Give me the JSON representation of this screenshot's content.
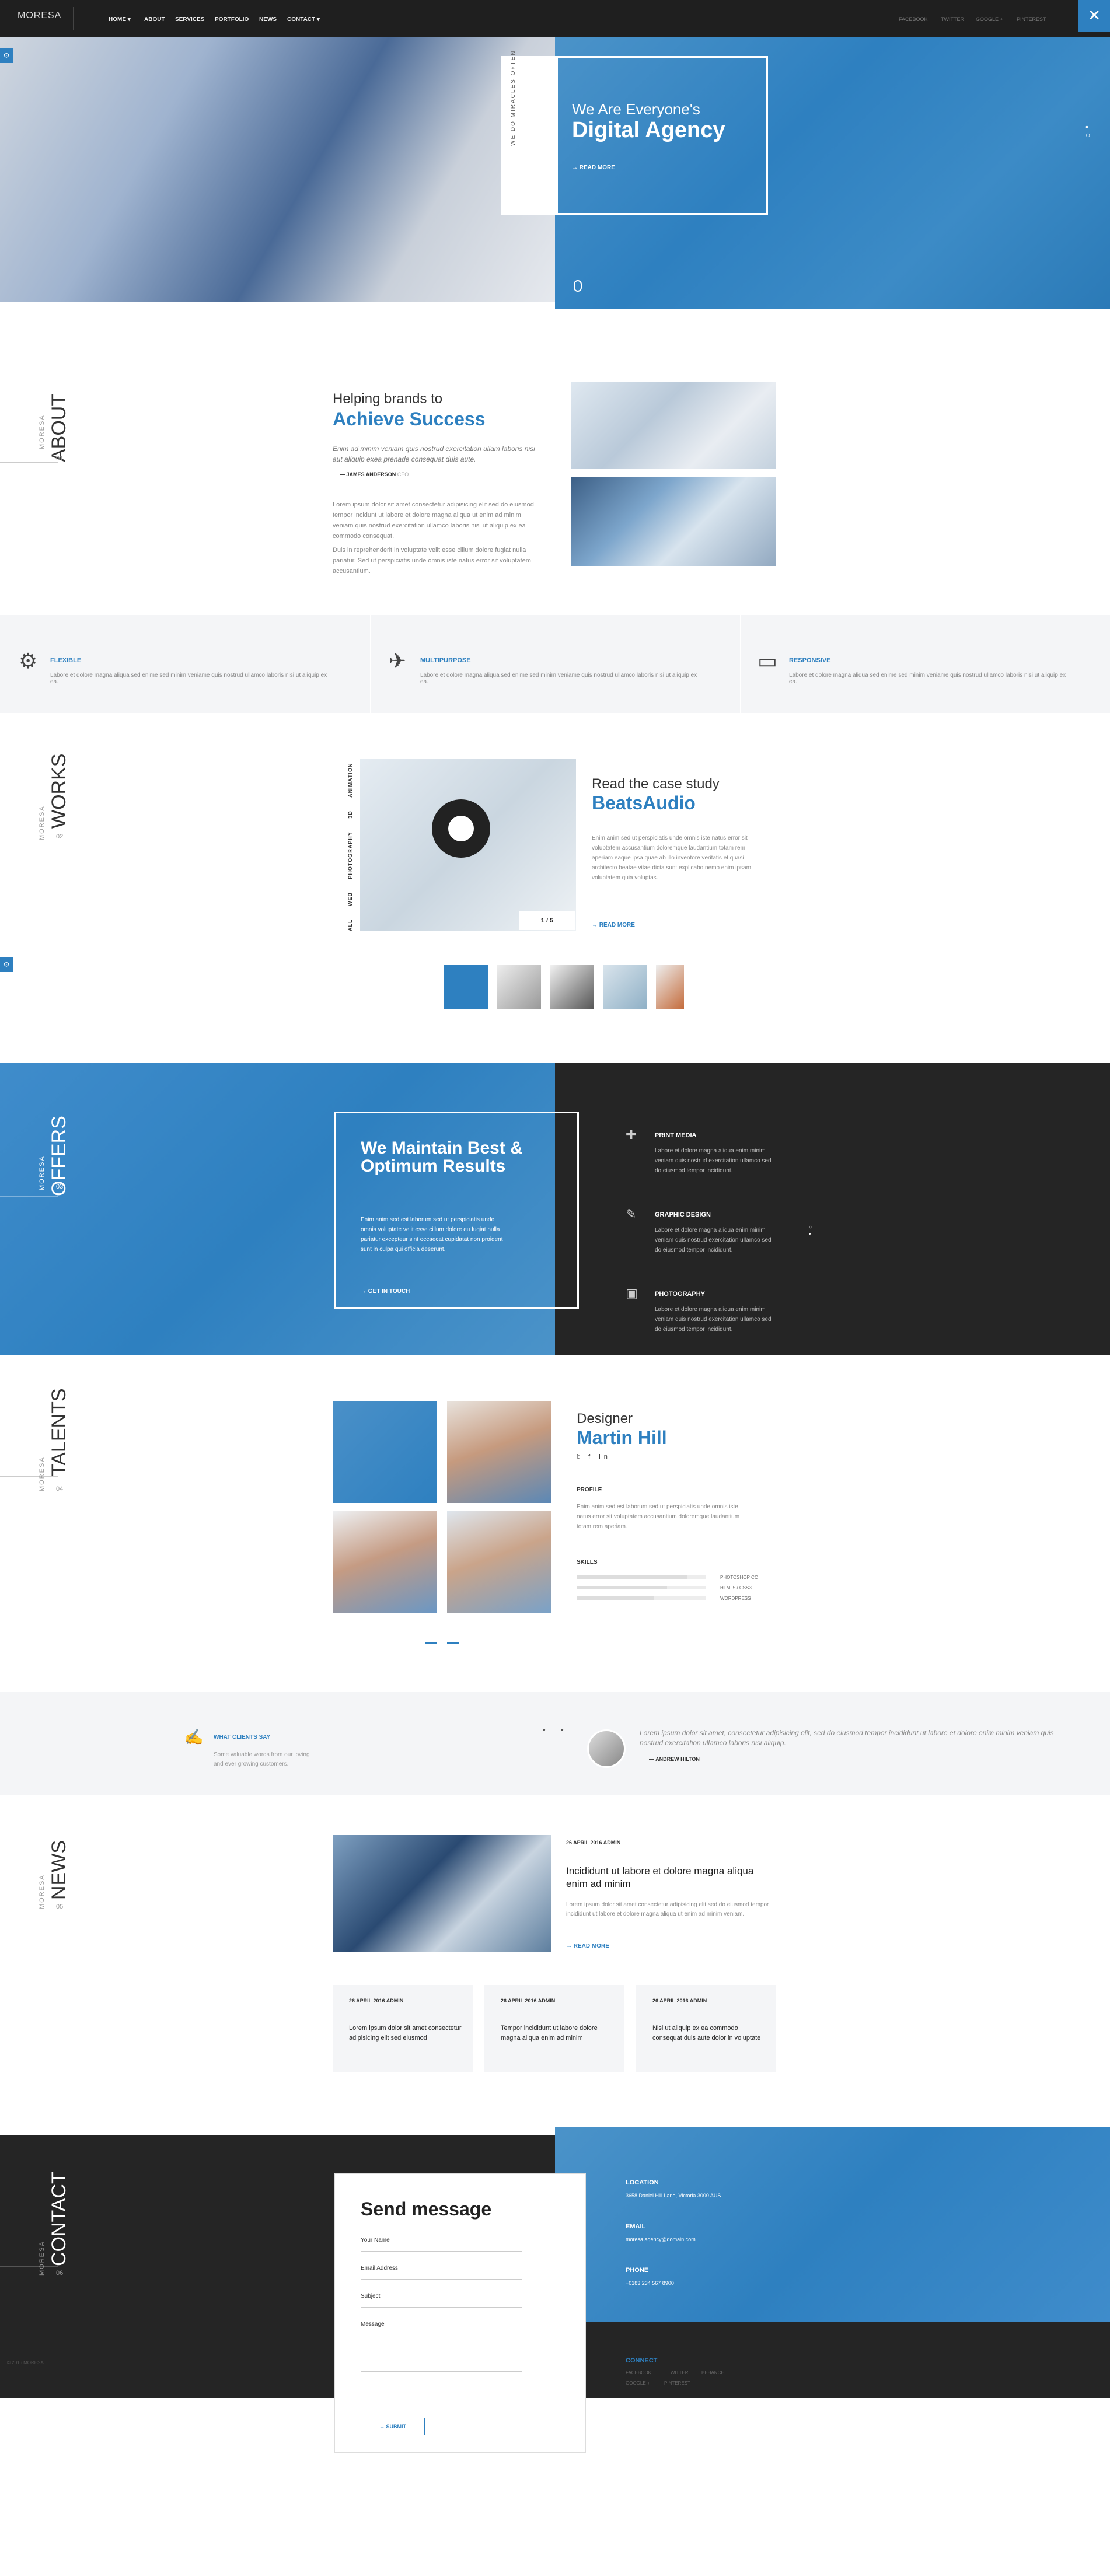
{
  "nav": {
    "logo": "MORESA",
    "items": [
      "HOME ▾",
      "ABOUT",
      "SERVICES",
      "PORTFOLIO",
      "NEWS",
      "CONTACT ▾"
    ],
    "social": [
      "FACEBOOK",
      "TWITTER",
      "GOOGLE +",
      "PINTEREST"
    ],
    "close": "✕"
  },
  "hero": {
    "tag": "WE DO MIRACLES OFTEN",
    "subtitle": "We Are Everyone's",
    "title": "Digital Agency",
    "cta": "READ MORE"
  },
  "about": {
    "section": "ABOUT",
    "brand": "MORESA",
    "num": "01",
    "subtitle": "Helping brands to",
    "title": "Achieve Success",
    "quote": "Enim ad minim veniam quis nostrud exercitation ullam laboris nisi aut aliquip exea prenade consequat duis aute.",
    "author": "JAMES ANDERSON",
    "author_role": "CEO",
    "p1": "Lorem ipsum dolor sit amet consectetur adipisicing elit sed do eiusmod tempor incidunt ut labore et dolore magna aliqua ut enim ad minim veniam quis nostrud exercitation ullamco laboris nisi ut aliquip ex ea commodo consequat.",
    "p2": "Duis in reprehenderit in voluptate velit esse cillum dolore fugiat nulla pariatur. Sed ut perspiciatis unde omnis iste natus error sit voluptatem accusantium."
  },
  "features": [
    {
      "icon": "⚙",
      "title": "FLEXIBLE",
      "text": "Labore et dolore magna aliqua sed enime sed minim veniame quis nostrud ullamco laboris nisi ut aliquip ex ea."
    },
    {
      "icon": "✈",
      "title": "MULTIPURPOSE",
      "text": "Labore et dolore magna aliqua sed enime sed minim veniame quis nostrud ullamco laboris nisi ut aliquip ex ea."
    },
    {
      "icon": "▭",
      "title": "RESPONSIVE",
      "text": "Labore et dolore magna aliqua sed enime sed minim veniame quis nostrud ullamco laboris nisi ut aliquip ex ea."
    }
  ],
  "works": {
    "section": "WORKS",
    "brand": "MORESA",
    "num": "02",
    "categories": [
      "ALL",
      "WEB",
      "PHOTOGRAPHY",
      "3D",
      "ANIMATION"
    ],
    "pager": "1 / 5",
    "subtitle": "Read the case study",
    "title": "BeatsAudio",
    "text": "Enim anim sed ut perspiciatis unde omnis iste natus error sit voluptatem accusantium doloremque laudantium totam rem aperiam eaque ipsa quae ab illo inventore veritatis et quasi architecto beatae vitae dicta sunt explicabo nemo enim ipsam voluptatem quia voluptas.",
    "cta": "READ MORE"
  },
  "offers": {
    "section": "OFFERS",
    "brand": "MORESA",
    "num": "03",
    "title": "We Maintain Best & Optimum Results",
    "text": "Enim anim sed est laborum sed ut perspiciatis unde omnis voluptate velit esse cillum dolore eu fugiat nulla pariatur excepteur sint occaecat cupidatat non proident sunt in culpa qui officia deserunt.",
    "cta": "GET IN TOUCH",
    "services": [
      {
        "icon": "✚",
        "title": "PRINT MEDIA",
        "text": "Labore et dolore magna aliqua enim minim veniam quis nostrud exercitation ullamco sed do eiusmod tempor incididunt."
      },
      {
        "icon": "✎",
        "title": "GRAPHIC DESIGN",
        "text": "Labore et dolore magna aliqua enim minim veniam quis nostrud exercitation ullamco sed do eiusmod tempor incididunt."
      },
      {
        "icon": "▣",
        "title": "PHOTOGRAPHY",
        "text": "Labore et dolore magna aliqua enim minim veniam quis nostrud exercitation ullamco sed do eiusmod tempor incididunt."
      }
    ]
  },
  "talents": {
    "section": "TALENTS",
    "brand": "MORESA",
    "num": "04",
    "role": "Designer",
    "name": "Martin Hill",
    "social": "𝕥 f in",
    "profile_label": "PROFILE",
    "profile": "Enim anim sed est laborum sed ut perspiciatis unde omnis iste natus error sit voluptatem accusantium doloremque laudantium totam rem aperiam.",
    "skills_label": "SKILLS",
    "skills": [
      {
        "name": "PHOTOSHOP CC",
        "level": 0.85
      },
      {
        "name": "HTML5 / CSS3",
        "level": 0.7
      },
      {
        "name": "WORDPRESS",
        "level": 0.6
      }
    ]
  },
  "testimonials": {
    "title": "WHAT CLIENTS SAY",
    "subtitle": "Some valuable words from our loving and ever growing customers.",
    "quote": "Lorem ipsum dolor sit amet, consectetur adipisicing elit, sed do eiusmod tempor incididunt ut labore et dolore enim minim veniam quis nostrud exercitation ullamco laboris nisi aliquip.",
    "author": "ANDREW HILTON"
  },
  "news": {
    "section": "NEWS",
    "brand": "MORESA",
    "num": "05",
    "meta": "26 APRIL 2016    ADMIN",
    "title": "Incididunt ut labore et dolore magna aliqua enim ad minim",
    "text": "Lorem ipsum dolor sit amet consectetur adipisicing elit sed do eiusmod tempor incididunt ut labore et dolore magna aliqua ut enim ad minim veniam.",
    "cta": "READ MORE",
    "cards": [
      {
        "meta": "26 APRIL 2016    ADMIN",
        "title": "Lorem ipsum dolor sit amet consectetur adipisicing elit sed eiusmod"
      },
      {
        "meta": "26 APRIL 2016    ADMIN",
        "title": "Tempor incididunt ut labore dolore magna aliqua enim ad minim"
      },
      {
        "meta": "26 APRIL 2016    ADMIN",
        "title": "Nisi ut aliquip ex ea commodo consequat duis aute dolor in voluptate"
      }
    ]
  },
  "contact": {
    "section": "CONTACT",
    "brand": "MORESA",
    "num": "06",
    "form_title": "Send message",
    "fields": [
      "Your Name",
      "Email Address",
      "Subject",
      "Message"
    ],
    "submit": "SUBMIT",
    "location_label": "LOCATION",
    "location": "3658 Daniel Hill Lane, Victoria 3000 AUS",
    "email_label": "EMAIL",
    "email": "moresa.agency@domain.com",
    "phone_label": "PHONE",
    "phone": "+0183 234 567 8900",
    "connect_label": "CONNECT",
    "connect": [
      "FACEBOOK",
      "TWITTER",
      "BEHANCE",
      "GOOGLE +",
      "PINTEREST"
    ],
    "copyright": "© 2016 MORESA"
  },
  "colors": {
    "accent": "#2e80c0",
    "dark": "#252525",
    "light": "#f4f5f7"
  }
}
